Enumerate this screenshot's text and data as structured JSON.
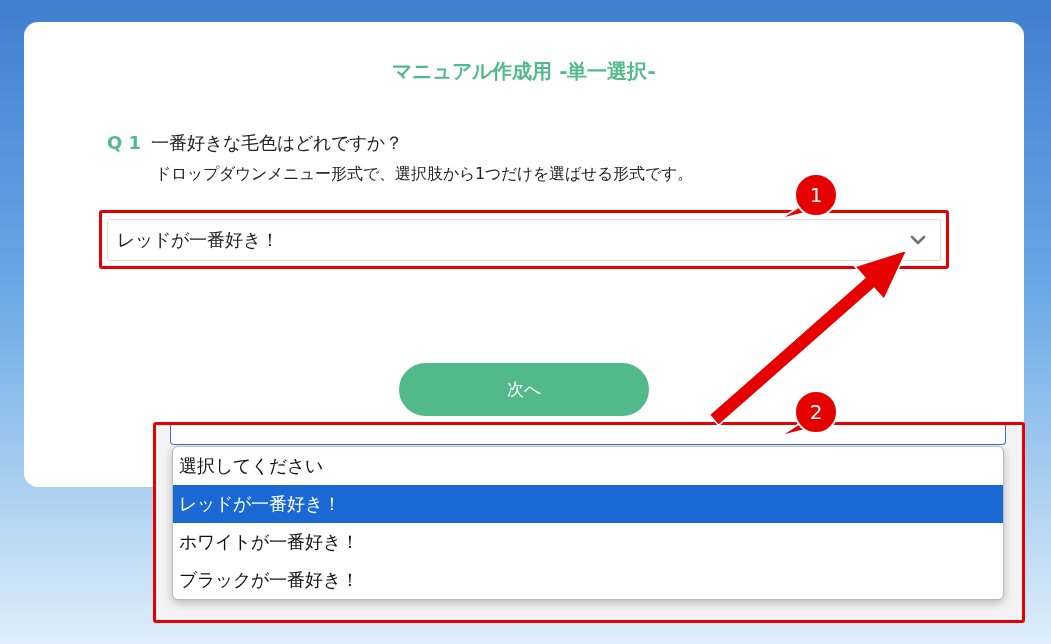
{
  "page": {
    "title": "マニュアル作成用 -単一選択-"
  },
  "question": {
    "number": "Q 1",
    "text": "一番好きな毛色はどれですか？",
    "description": "ドロップダウンメニュー形式で、選択肢から1つだけを選ばせる形式です。"
  },
  "select": {
    "value": "レッドが一番好き！",
    "expanded": true,
    "options": [
      {
        "label": "選択してください",
        "selected": false
      },
      {
        "label": "レッドが一番好き！",
        "selected": true
      },
      {
        "label": "ホワイトが一番好き！",
        "selected": false
      },
      {
        "label": "ブラックが一番好き！",
        "selected": false
      }
    ]
  },
  "next_button": {
    "label": "次へ"
  },
  "annotations": [
    {
      "number": "1"
    },
    {
      "number": "2"
    }
  ]
}
